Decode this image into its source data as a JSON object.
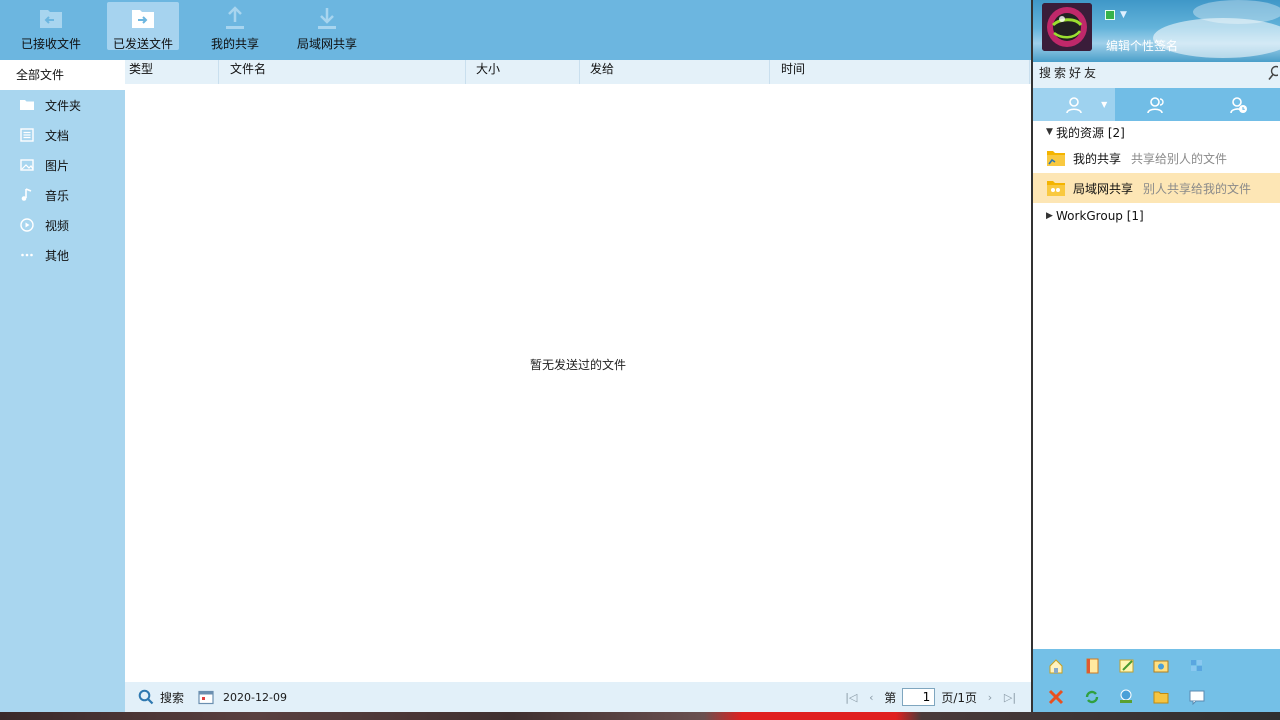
{
  "toolbar": {
    "received_label": "已接收文件",
    "sent_label": "已发送文件",
    "myshare_label": "我的共享",
    "lanshare_label": "局域网共享"
  },
  "sidebar": {
    "all_files": "全部文件",
    "items": [
      {
        "label": "文件夹",
        "icon": "folder-icon"
      },
      {
        "label": "文档",
        "icon": "document-icon"
      },
      {
        "label": "图片",
        "icon": "image-icon"
      },
      {
        "label": "音乐",
        "icon": "music-icon"
      },
      {
        "label": "视频",
        "icon": "video-icon"
      },
      {
        "label": "其他",
        "icon": "more-icon"
      }
    ]
  },
  "table": {
    "columns": [
      "类型",
      "文件名",
      "大小",
      "发给",
      "时间"
    ],
    "empty_message": "暂无发送过的文件"
  },
  "statusbar": {
    "search_label": "搜索",
    "date": "2020-12-09",
    "page_prefix": "第",
    "page_value": "1",
    "page_suffix": "页/1页"
  },
  "right_panel": {
    "signature": "编辑个性签名",
    "friend_search": "搜索好友",
    "group_label": "我的资源 [2]",
    "resources": [
      {
        "name": "我的共享",
        "desc": "共享给别人的文件"
      },
      {
        "name": "局域网共享",
        "desc": "别人共享给我的文件"
      }
    ],
    "workgroup_label": "WorkGroup [1]"
  },
  "colors": {
    "toolbar_bg": "#6cb6e0",
    "sidebar_bg": "#a9d6ef",
    "selection_bg": "#fde6b5",
    "status_green": "#37b24a"
  }
}
